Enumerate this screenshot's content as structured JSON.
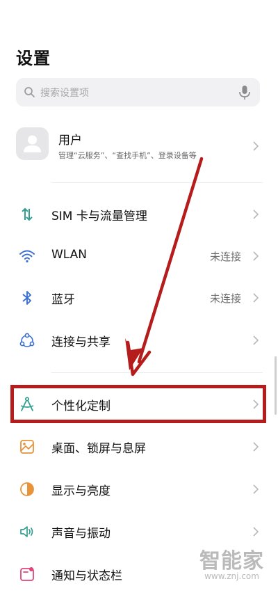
{
  "header": {
    "title": "设置"
  },
  "search": {
    "placeholder": "搜索设置项",
    "icon": "search-icon",
    "voice_icon": "mic-icon"
  },
  "account": {
    "name": "用户",
    "subtitle": "管理“云服务”、“查找手机”、登录设备等"
  },
  "settings": [
    {
      "icon": "sim-data-icon",
      "label": "SIM 卡与流量管理",
      "status": ""
    },
    {
      "icon": "wifi-icon",
      "label": "WLAN",
      "status": "未连接"
    },
    {
      "icon": "bluetooth-icon",
      "label": "蓝牙",
      "status": "未连接"
    },
    {
      "icon": "connection-share-icon",
      "label": "连接与共享",
      "status": ""
    },
    {
      "icon": "personalization-icon",
      "label": "个性化定制",
      "status": ""
    },
    {
      "icon": "wallpaper-icon",
      "label": "桌面、锁屏与息屏",
      "status": ""
    },
    {
      "icon": "display-brightness-icon",
      "label": "显示与亮度",
      "status": ""
    },
    {
      "icon": "sound-icon",
      "label": "声音与振动",
      "status": ""
    },
    {
      "icon": "notification-icon",
      "label": "通知与状态栏",
      "status": ""
    }
  ],
  "watermark": {
    "logo": "智能家",
    "url": "www.znj.com"
  },
  "colors": {
    "annotation_red": "#b51c1c",
    "text_primary": "#111111",
    "text_secondary": "#6b6b6b",
    "icon_teal": "#2f9f8f",
    "icon_orange": "#e8923a",
    "icon_blue": "#3b6fd4",
    "icon_pink": "#e0457a"
  }
}
